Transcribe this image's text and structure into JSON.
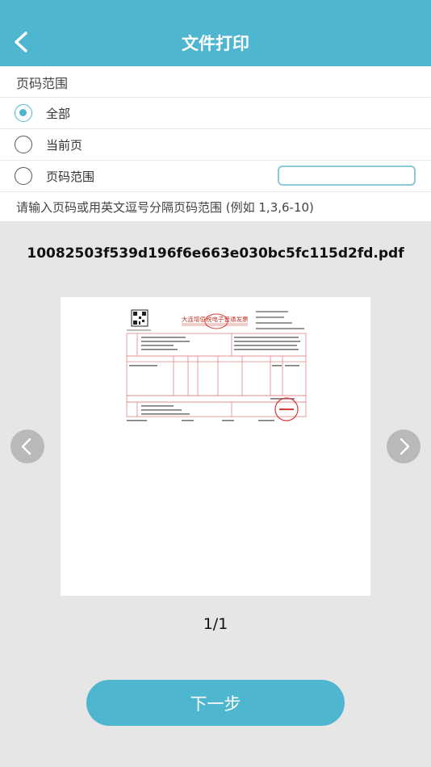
{
  "header": {
    "title": "文件打印"
  },
  "page_range": {
    "label": "页码范围",
    "options": [
      {
        "label": "全部",
        "selected": true
      },
      {
        "label": "当前页",
        "selected": false
      },
      {
        "label": "页码范围",
        "selected": false
      }
    ],
    "range_input_value": "",
    "hint": "请输入页码或用英文逗号分隔页码范围 (例如 1,3,6-10)"
  },
  "document": {
    "filename": "10082503f539d196f6e663e030bc5fc115d2fd.pdf",
    "page_counter": "1/1",
    "invoice_title": "大连增值税电子普通发票"
  },
  "actions": {
    "next_label": "下一步"
  },
  "colors": {
    "accent": "#4fb6cf",
    "background": "#e6e6e6",
    "stamp": "#d83a3a"
  },
  "icons": {
    "back": "chevron-left-icon",
    "prev": "chevron-left-icon",
    "next": "chevron-right-icon"
  }
}
